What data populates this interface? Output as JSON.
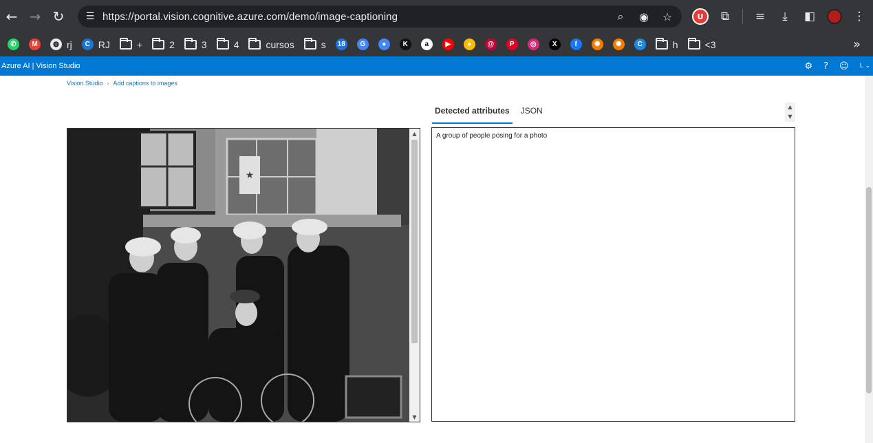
{
  "browser": {
    "url": "https://portal.vision.cognitive.azure.com/demo/image-captioning",
    "bookmarks": [
      {
        "name": "whatsapp",
        "label": "",
        "color": "#25d366",
        "icon": "whatsapp-icon",
        "glyph": "✆"
      },
      {
        "name": "gmail",
        "label": "",
        "color": "#ea4335",
        "icon": "gmail-icon",
        "glyph": "M"
      },
      {
        "name": "rj-globe",
        "label": "rj",
        "color": "#e8eaed",
        "icon": "globe-icon",
        "glyph": "◍"
      },
      {
        "name": "rj-app",
        "label": "RJ",
        "color": "#1976d2",
        "icon": "rj-app-icon",
        "glyph": "C"
      },
      {
        "name": "folder-plus",
        "label": "+",
        "folder": true
      },
      {
        "name": "folder-2",
        "label": "2",
        "folder": true
      },
      {
        "name": "folder-3",
        "label": "3",
        "folder": true
      },
      {
        "name": "folder-4",
        "label": "4",
        "folder": true
      },
      {
        "name": "folder-cursos",
        "label": "cursos",
        "folder": true
      },
      {
        "name": "folder-s",
        "label": "s",
        "folder": true
      },
      {
        "name": "calendar",
        "label": "",
        "color": "#1a73e8",
        "icon": "calendar-icon",
        "glyph": "18"
      },
      {
        "name": "translate",
        "label": "",
        "color": "#4285f4",
        "icon": "translate-icon",
        "glyph": "G"
      },
      {
        "name": "assistant",
        "label": "",
        "color": "#4285f4",
        "icon": "assistant-icon",
        "glyph": "●"
      },
      {
        "name": "k-app",
        "label": "",
        "color": "#111111",
        "icon": "k-app-icon",
        "glyph": "K"
      },
      {
        "name": "amazon",
        "label": "",
        "color": "#ffffff",
        "icon": "amazon-icon",
        "glyph": "a"
      },
      {
        "name": "youtube-music",
        "label": "",
        "color": "#ff0000",
        "icon": "youtube-music-icon",
        "glyph": "▶"
      },
      {
        "name": "chrome-like",
        "label": "",
        "color": "#fbbc04",
        "icon": "circle-app-icon",
        "glyph": "●"
      },
      {
        "name": "debian",
        "label": "",
        "color": "#c70036",
        "icon": "swirl-icon",
        "glyph": "@"
      },
      {
        "name": "pinterest",
        "label": "",
        "color": "#e60023",
        "icon": "pinterest-icon",
        "glyph": "P"
      },
      {
        "name": "instagram",
        "label": "",
        "color": "#d62976",
        "icon": "instagram-icon",
        "glyph": "◎"
      },
      {
        "name": "x",
        "label": "",
        "color": "#000000",
        "icon": "x-icon",
        "glyph": "X"
      },
      {
        "name": "facebook",
        "label": "",
        "color": "#1877f2",
        "icon": "facebook-icon",
        "glyph": "f"
      },
      {
        "name": "orange-app-1",
        "label": "",
        "color": "#f57c00",
        "icon": "orange-gear-icon",
        "glyph": "✺"
      },
      {
        "name": "orange-app-2",
        "label": "",
        "color": "#f57c00",
        "icon": "orange-gear-icon",
        "glyph": "✺"
      },
      {
        "name": "edge-like",
        "label": "",
        "color": "#1e88e5",
        "icon": "refresh-app-icon",
        "glyph": "C"
      },
      {
        "name": "folder-h",
        "label": "h",
        "folder": true
      },
      {
        "name": "folder-3-heart",
        "label": "<3",
        "folder": true
      }
    ]
  },
  "app": {
    "title": "Azure AI  |  Vision Studio"
  },
  "breadcrumb": {
    "root": "Vision Studio",
    "current": "Add captions to images"
  },
  "tabs": {
    "detected": "Detected attributes",
    "json": "JSON"
  },
  "result": {
    "caption": "A group of people posing for a photo"
  },
  "colors": {
    "accent": "#0078d4",
    "chrome": "#35363a"
  }
}
